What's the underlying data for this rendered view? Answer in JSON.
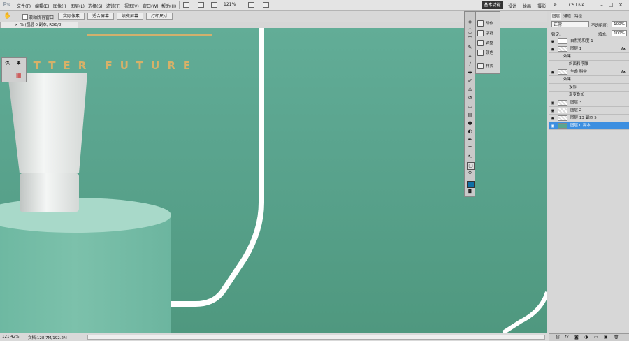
{
  "app": {
    "logo": "Ps"
  },
  "menu": [
    "文件(F)",
    "编辑(E)",
    "图像(I)",
    "图层(L)",
    "选择(S)",
    "滤镜(T)",
    "视图(V)",
    "窗口(W)",
    "帮助(H)"
  ],
  "menubar": {
    "zoom": "121%",
    "workspace_active": "基本功能",
    "workspaces": [
      "设计",
      "绘画",
      "摄影"
    ],
    "more": "»",
    "cs_live": "CS Live"
  },
  "options": {
    "scroll_all_label": "滚动所有窗口",
    "buttons": [
      "实际像素",
      "适合屏幕",
      "填充屏幕",
      "打印尺寸"
    ]
  },
  "document": {
    "tab_title": "% (图层 0 副本, RGB/8)",
    "headline": "BETTER FUTURE",
    "close_mark": "×"
  },
  "collapsed_panels": [
    "动作",
    "字符",
    "调整",
    "颜色",
    "样式"
  ],
  "layers_panel": {
    "tabs": [
      "图层",
      "通道",
      "路径"
    ],
    "blend_mode": "正常",
    "opacity_label": "不透明度:",
    "opacity": "100%",
    "lock_label": "锁定:",
    "fill_label": "填充:",
    "fill": "100%",
    "rows": [
      {
        "name": "自然饱和度 1",
        "type": "adjustment"
      },
      {
        "name": "图层 1",
        "fx": "fx"
      },
      {
        "name": "效果",
        "type": "sub"
      },
      {
        "name": "斜面和浮雕",
        "type": "sub2"
      },
      {
        "name": "生命 科学",
        "fx": "fx"
      },
      {
        "name": "效果",
        "type": "sub"
      },
      {
        "name": "投影",
        "type": "sub2"
      },
      {
        "name": "渐变叠加",
        "type": "sub2"
      },
      {
        "name": "图层 3"
      },
      {
        "name": "图层 2"
      },
      {
        "name": "图层 13 副本 5"
      },
      {
        "name": "图层 0 副本",
        "selected": true
      }
    ]
  },
  "status": {
    "zoom": "121.42%",
    "doc": "文档:128.7M/192.2M"
  },
  "colors": {
    "canvas": "#5aa58f",
    "gold": "#d7b168",
    "foreground": "#0f6fa5",
    "selection": "#3d8fe0"
  }
}
